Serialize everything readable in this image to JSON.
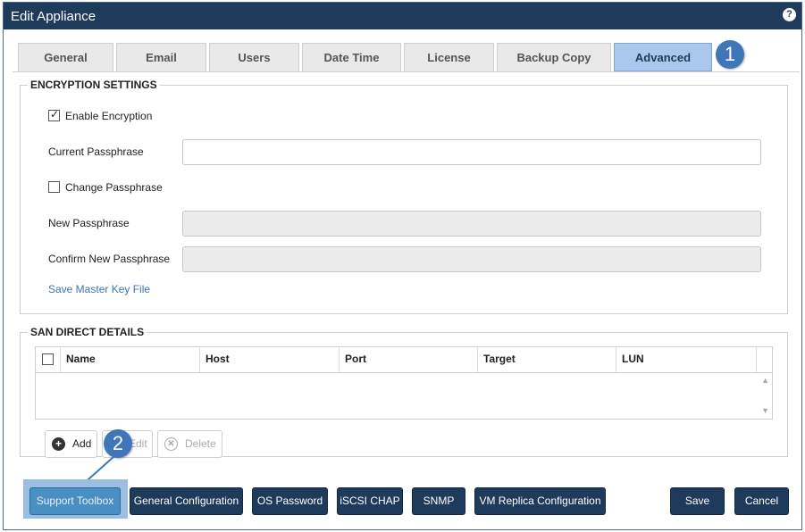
{
  "window": {
    "title": "Edit Appliance",
    "help_icon": "help-icon"
  },
  "tabs": [
    {
      "label": "General"
    },
    {
      "label": "Email"
    },
    {
      "label": "Users"
    },
    {
      "label": "Date Time"
    },
    {
      "label": "License"
    },
    {
      "label": "Backup Copy"
    },
    {
      "label": "Advanced",
      "active": true
    }
  ],
  "callouts": {
    "first": "1",
    "second": "2"
  },
  "encryption": {
    "legend": "ENCRYPTION SETTINGS",
    "enable_label": "Enable Encryption",
    "enable_checked": true,
    "current_label": "Current Passphrase",
    "current_value": "",
    "change_label": "Change Passphrase",
    "change_checked": false,
    "new_label": "New Passphrase",
    "confirm_label": "Confirm New Passphrase",
    "save_key_link": "Save Master Key File"
  },
  "san": {
    "legend": "SAN DIRECT DETAILS",
    "columns": [
      "Name",
      "Host",
      "Port",
      "Target",
      "LUN"
    ],
    "rows": [],
    "add_label": "Add",
    "edit_label": "Edit",
    "delete_label": "Delete"
  },
  "footer": {
    "support_toolbox": "Support Toolbox",
    "general_configuration": "General Configuration",
    "os_password": "OS Password",
    "iscsi_chap": "iSCSI CHAP",
    "snmp": "SNMP",
    "vm_replica": "VM Replica Configuration",
    "save": "Save",
    "cancel": "Cancel"
  },
  "colors": {
    "titlebar": "#1f3b5c",
    "active_tab": "#a9c8ec",
    "callout": "#3f76b8",
    "button": "#1f3b5c",
    "highlight": "#9bbde0"
  }
}
